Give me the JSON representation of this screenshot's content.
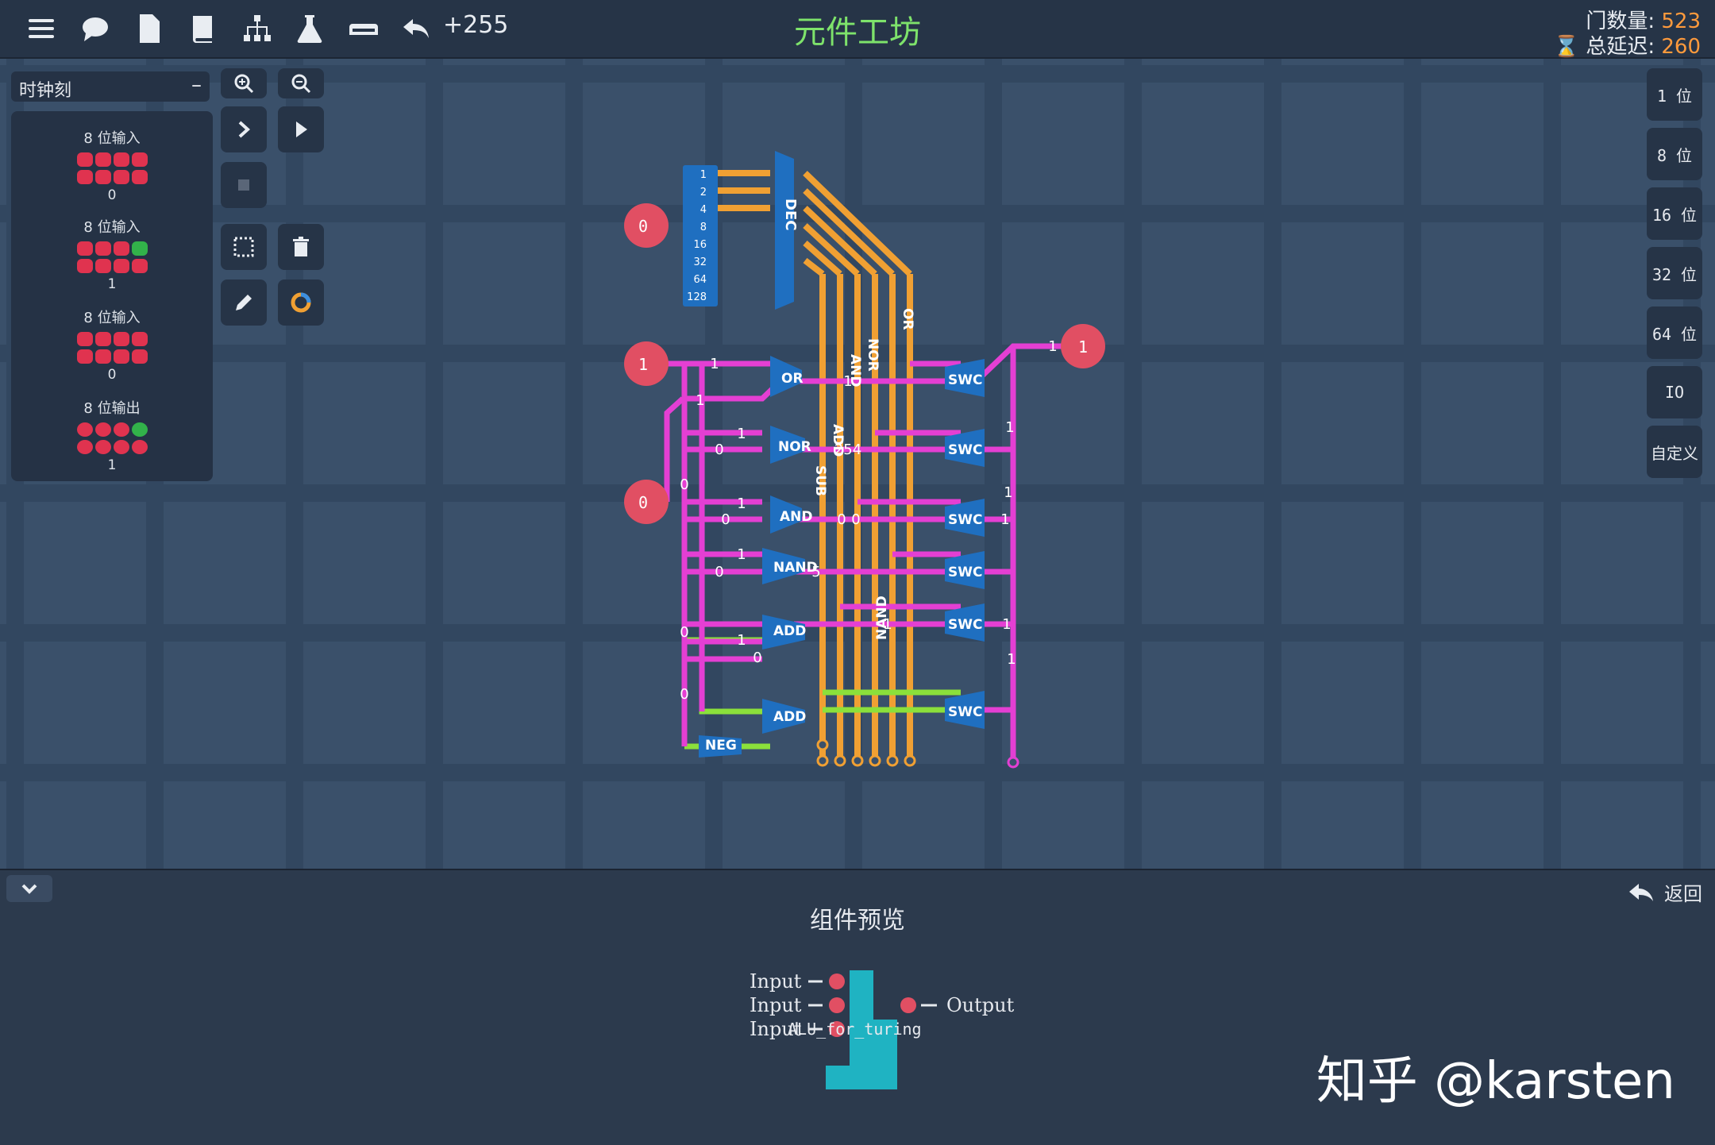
{
  "topbar": {
    "icons": [
      "menu-icon",
      "chat-icon",
      "file-icon",
      "book-icon",
      "hierarchy-icon",
      "flask-icon",
      "keyboard-icon",
      "undo-icon"
    ],
    "level_count": "+255",
    "title": "元件工坊",
    "gate_label": "门数量:",
    "gate_value": "523",
    "delay_label": "总延迟:",
    "delay_value": "260"
  },
  "left_panel": {
    "clock_label": "时钟刻",
    "clock_collapse": "–",
    "io_items": [
      {
        "title": "8 位输入",
        "value": "0"
      },
      {
        "title": "8 位输入",
        "value": "1"
      },
      {
        "title": "8 位输入",
        "value": "0"
      },
      {
        "title": "8 位输出",
        "value": "1"
      }
    ]
  },
  "width_buttons": [
    "1 位",
    "8 位",
    "16 位",
    "32 位",
    "64 位",
    "IO",
    "自定义"
  ],
  "circuit": {
    "inputs": [
      "0",
      "1",
      "0"
    ],
    "output": "1",
    "decoder_label": "DEC",
    "decoder_bits": [
      "1",
      "2",
      "4",
      "8",
      "16",
      "32",
      "64",
      "128"
    ],
    "gates": [
      "OR",
      "NOR",
      "AND",
      "NAND",
      "ADD",
      "ADD",
      "NEG"
    ],
    "switches": [
      "SWC",
      "SWC",
      "SWC",
      "SWC",
      "SWC",
      "SWC"
    ],
    "bus_labels": [
      "OR",
      "NOR",
      "AND",
      "ADD",
      "SUB",
      "NAND"
    ],
    "wire_values": [
      "1",
      "1",
      "1",
      "0",
      "1",
      "0",
      "1",
      "0",
      "1",
      "0",
      "1",
      "0",
      "254",
      "0",
      "5",
      "1",
      "1",
      "1",
      "1",
      "1",
      "1",
      "1",
      "0",
      "0",
      "0"
    ]
  },
  "bottom_panel": {
    "back_label": "返回",
    "preview_title": "组件预览",
    "inputs": [
      "Input",
      "Input",
      "Input"
    ],
    "output": "Output",
    "component_name": "ALU_for_turing"
  },
  "watermark": "知乎 @karsten"
}
